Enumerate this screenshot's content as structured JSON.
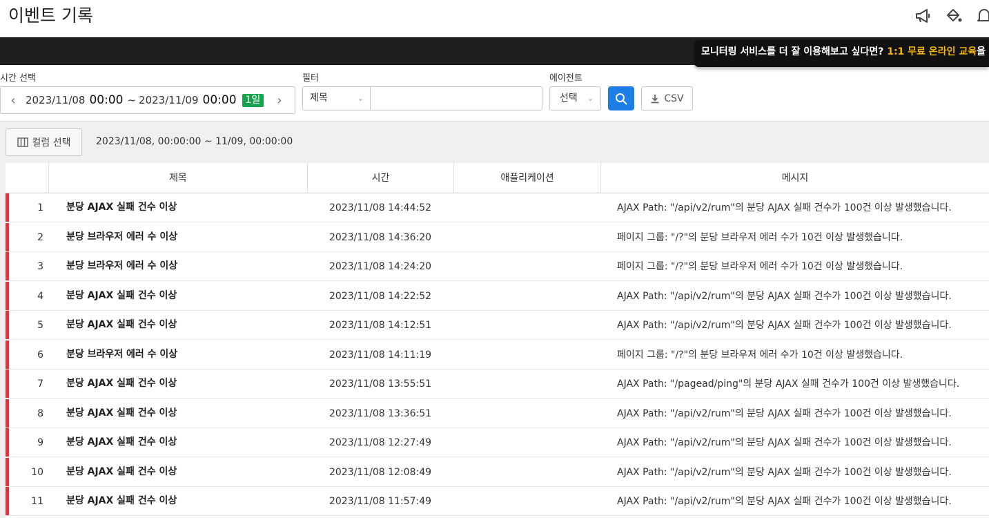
{
  "header": {
    "title": "이벤트 기록",
    "icons": [
      "megaphone-icon",
      "paint-bucket-icon",
      "bell-icon"
    ]
  },
  "promo": {
    "text": "모니터링 서비스를 더 잘 이용해보고 싶다면? ",
    "highlight": "1:1 무료 온라인 교육",
    "suffix": "을"
  },
  "filters": {
    "time_label": "시간 선택",
    "start_date": "2023/11/08",
    "start_time": "00:00",
    "tilde": "~",
    "end_date": "2023/11/09",
    "end_time": "00:00",
    "range_badge": "1일",
    "filter_label": "필터",
    "filter_field": "제목",
    "filter_value": "",
    "agent_label": "에이전트",
    "agent_value": "선택",
    "csv_label": "CSV"
  },
  "toolbar": {
    "column_select_label": "컬럼 선택",
    "range_text": "2023/11/08, 00:00:00 ~ 11/09, 00:00:00"
  },
  "table": {
    "columns": [
      "제목",
      "시간",
      "애플리케이션",
      "메시지"
    ],
    "rows": [
      {
        "idx": "1",
        "title": "분당 AJAX 실패 건수 이상",
        "time": "2023/11/08 14:44:52",
        "app": "",
        "msg": "AJAX Path: \"/api/v2/rum\"의 분당 AJAX 실패 건수가 100건 이상 발생했습니다."
      },
      {
        "idx": "2",
        "title": "분당 브라우저 에러 수 이상",
        "time": "2023/11/08 14:36:20",
        "app": "",
        "msg": "페이지 그룹: \"/?\"의 분당 브라우저 에러 수가 10건 이상 발생했습니다."
      },
      {
        "idx": "3",
        "title": "분당 브라우저 에러 수 이상",
        "time": "2023/11/08 14:24:20",
        "app": "",
        "msg": "페이지 그룹: \"/?\"의 분당 브라우저 에러 수가 10건 이상 발생했습니다."
      },
      {
        "idx": "4",
        "title": "분당 AJAX 실패 건수 이상",
        "time": "2023/11/08 14:22:52",
        "app": "",
        "msg": "AJAX Path: \"/api/v2/rum\"의 분당 AJAX 실패 건수가 100건 이상 발생했습니다."
      },
      {
        "idx": "5",
        "title": "분당 AJAX 실패 건수 이상",
        "time": "2023/11/08 14:12:51",
        "app": "",
        "msg": "AJAX Path: \"/api/v2/rum\"의 분당 AJAX 실패 건수가 100건 이상 발생했습니다."
      },
      {
        "idx": "6",
        "title": "분당 브라우저 에러 수 이상",
        "time": "2023/11/08 14:11:19",
        "app": "",
        "msg": "페이지 그룹: \"/?\"의 분당 브라우저 에러 수가 10건 이상 발생했습니다."
      },
      {
        "idx": "7",
        "title": "분당 AJAX 실패 건수 이상",
        "time": "2023/11/08 13:55:51",
        "app": "",
        "msg": "AJAX Path: \"/pagead/ping\"의 분당 AJAX 실패 건수가 100건 이상 발생했습니다."
      },
      {
        "idx": "8",
        "title": "분당 AJAX 실패 건수 이상",
        "time": "2023/11/08 13:36:51",
        "app": "",
        "msg": "AJAX Path: \"/api/v2/rum\"의 분당 AJAX 실패 건수가 100건 이상 발생했습니다."
      },
      {
        "idx": "9",
        "title": "분당 AJAX 실패 건수 이상",
        "time": "2023/11/08 12:27:49",
        "app": "",
        "msg": "AJAX Path: \"/api/v2/rum\"의 분당 AJAX 실패 건수가 100건 이상 발생했습니다."
      },
      {
        "idx": "10",
        "title": "분당 AJAX 실패 건수 이상",
        "time": "2023/11/08 12:08:49",
        "app": "",
        "msg": "AJAX Path: \"/api/v2/rum\"의 분당 AJAX 실패 건수가 100건 이상 발생했습니다."
      },
      {
        "idx": "11",
        "title": "분당 AJAX 실패 건수 이상",
        "time": "2023/11/08 11:57:49",
        "app": "",
        "msg": "AJAX Path: \"/api/v2/rum\"의 분당 AJAX 실패 건수가 100건 이상 발생했습니다."
      }
    ]
  },
  "colors": {
    "accent": "#1d7ee6",
    "badge": "#14a44d",
    "alert_bar": "#d9343d",
    "promo_highlight": "#f5b400"
  }
}
